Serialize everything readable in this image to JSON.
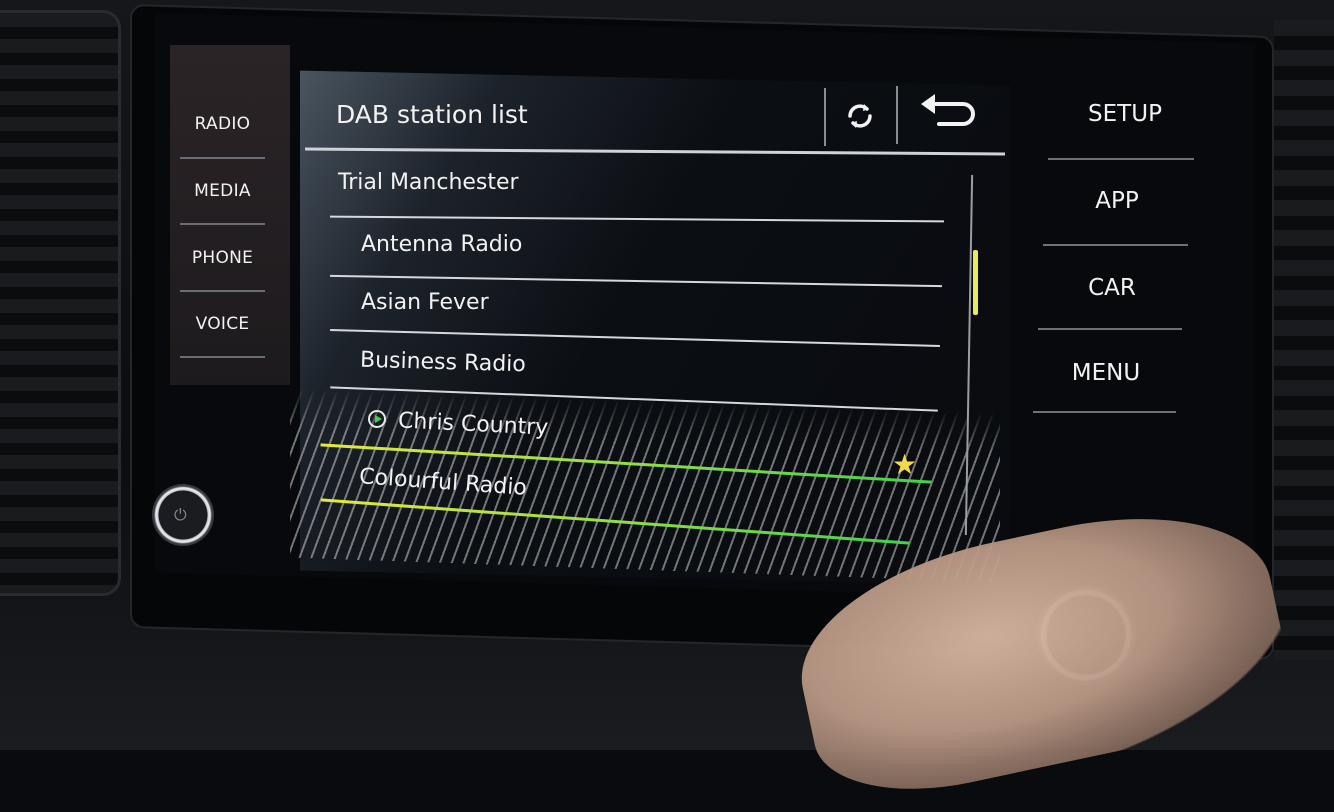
{
  "left_nav": {
    "items": [
      {
        "label": "RADIO"
      },
      {
        "label": "MEDIA"
      },
      {
        "label": "PHONE"
      },
      {
        "label": "VOICE"
      }
    ]
  },
  "header": {
    "title": "DAB station list",
    "refresh_icon": "refresh-icon",
    "back_icon": "back-arrow-icon"
  },
  "station_list": {
    "group": "Trial Manchester",
    "stations": [
      {
        "label": "Antenna Radio"
      },
      {
        "label": "Asian Fever"
      },
      {
        "label": "Business Radio"
      },
      {
        "label": "Chris Country",
        "playing": true
      },
      {
        "label": "Colourful Radio",
        "selected": true,
        "favorite": true
      }
    ],
    "accent_selected": "#3fd34a",
    "scroll_position_fraction": 0.2
  },
  "right_nav": {
    "items": [
      {
        "label": "SETUP"
      },
      {
        "label": "APP"
      },
      {
        "label": "CAR"
      },
      {
        "label": "MENU"
      }
    ]
  },
  "symbols": {
    "star": "★",
    "refresh": "⟳",
    "back": "⮌",
    "power": "⏻"
  }
}
